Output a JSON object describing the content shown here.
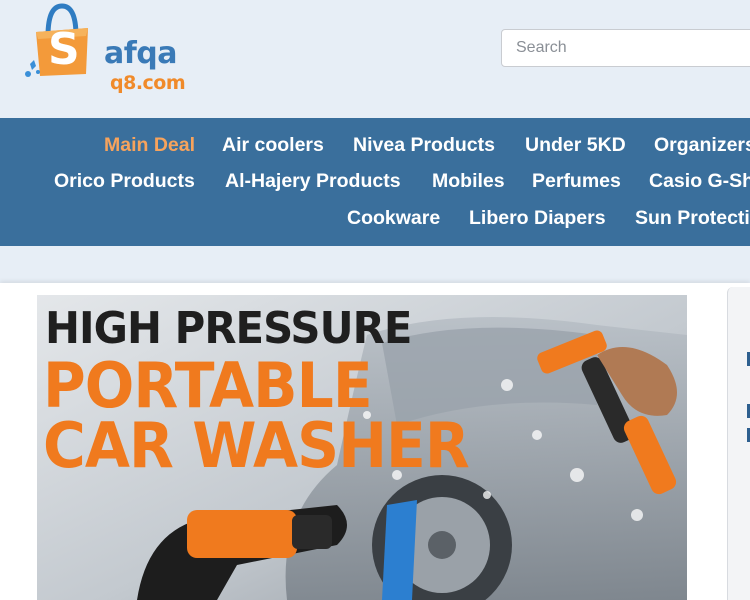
{
  "logo": {
    "text_main": "afqa",
    "text_sub": "q8.com",
    "bag_letter": "S"
  },
  "search": {
    "placeholder": "Search",
    "value": ""
  },
  "nav": {
    "row1": [
      "Main Deal",
      "Air coolers",
      "Nivea Products",
      "Under 5KD",
      "Organizers"
    ],
    "row2": [
      "Orico Products",
      "Al-Hajery Products",
      "Mobiles",
      "Perfumes",
      "Casio G-Shock"
    ],
    "row3": [
      "Cookware",
      "Libero Diapers",
      "Sun Protection"
    ],
    "active": "Main Deal"
  },
  "banner": {
    "line1": "HIGH PRESSURE",
    "line2": "PORTABLE",
    "line3": "CAR WASHER"
  },
  "colors": {
    "header_bg": "#e7eef6",
    "nav_bg": "#3a6f9c",
    "nav_active": "#f7a35c",
    "brand_blue": "#3a7ab7",
    "brand_orange": "#f08a2a",
    "banner_orange": "#f07a1e"
  }
}
